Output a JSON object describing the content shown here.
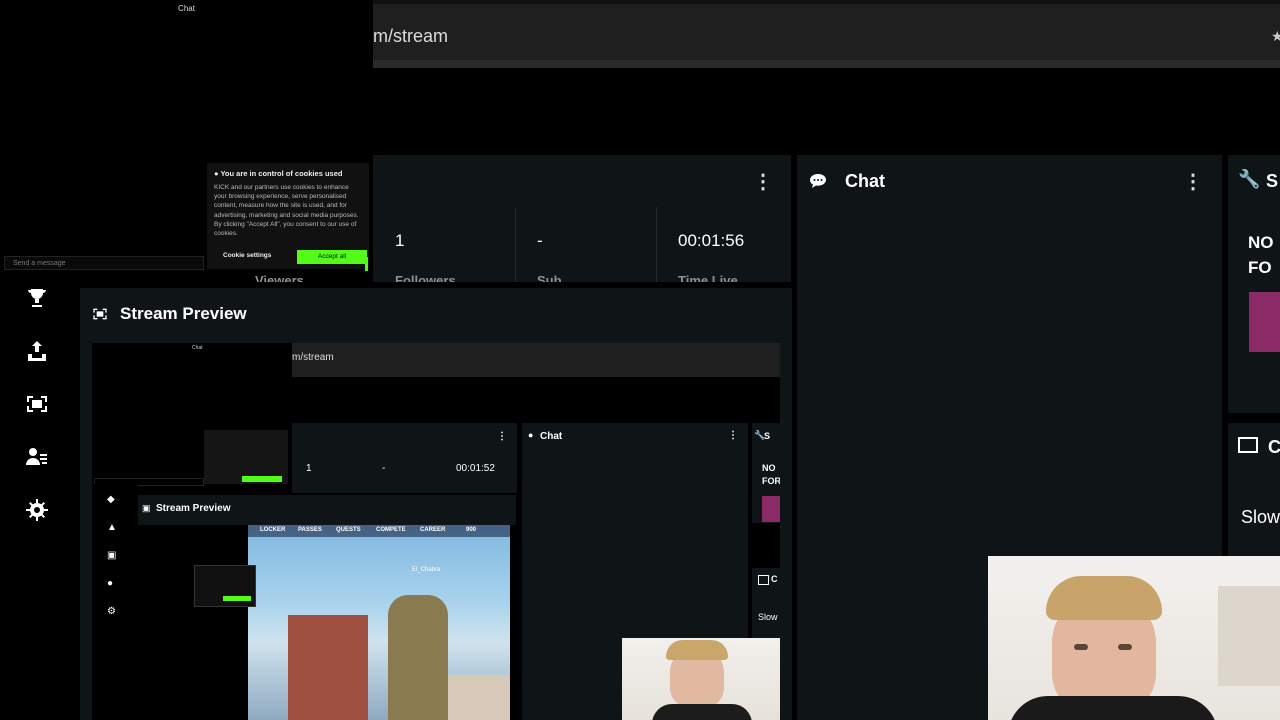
{
  "chat_popout": {
    "title": "Chat",
    "send_placeholder": "Send a message"
  },
  "cookie_banner": {
    "heading": "You are in control of cookies used",
    "body": "KICK and our partners use cookies to enhance your browsing experience, serve personalised content, measure how the site is used, and for advertising, marketing and social media purposes. By clicking \"Accept All\", you consent to our use of cookies.",
    "settings_label": "Cookie settings",
    "accept_label": "Accept all"
  },
  "browser": {
    "url": "m/stream"
  },
  "stats": {
    "values": [
      "1",
      "-",
      "00:01:56"
    ],
    "labels": [
      "Viewers",
      "Followers",
      "Sub",
      "Time Live"
    ]
  },
  "chat_panel": {
    "title": "Chat"
  },
  "right_panel": {
    "title_partial": "S",
    "text_line1": "NO",
    "text_line2": "FO",
    "section2_title": "C",
    "slow_label": "Slow"
  },
  "left_nav": {
    "items": [
      "trophy-icon",
      "upload-icon",
      "preview-icon",
      "users-icon",
      "settings-icon"
    ]
  },
  "stream_preview": {
    "title": "Stream Preview",
    "nested": {
      "url": "m/stream",
      "stat_values": [
        "1",
        "-",
        "00:01:52"
      ],
      "chat_title": "Chat",
      "right_title": "S",
      "right_line1": "NO",
      "right_line2": "FOR",
      "right_section2": "C",
      "slow_label": "Slow",
      "preview_title": "Stream Preview",
      "game_menu": [
        "LOCKER",
        "PASSES",
        "QUESTS",
        "COMPETE",
        "CAREER",
        "900"
      ],
      "player_name": "El_Chabra"
    }
  },
  "colors": {
    "accent": "#53fc18",
    "panel": "#0f1416",
    "bg": "#000000"
  }
}
